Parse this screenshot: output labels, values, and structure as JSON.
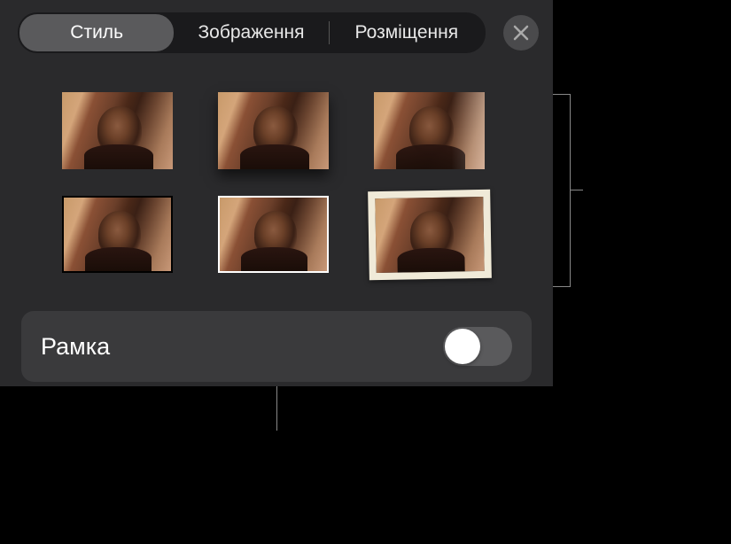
{
  "tabs": {
    "style": "Стиль",
    "image": "Зображення",
    "layout": "Розміщення"
  },
  "activeTab": "style",
  "styleOptions": {
    "count": 6,
    "selectedIndex": 5
  },
  "frameRow": {
    "label": "Рамка",
    "enabled": false
  }
}
